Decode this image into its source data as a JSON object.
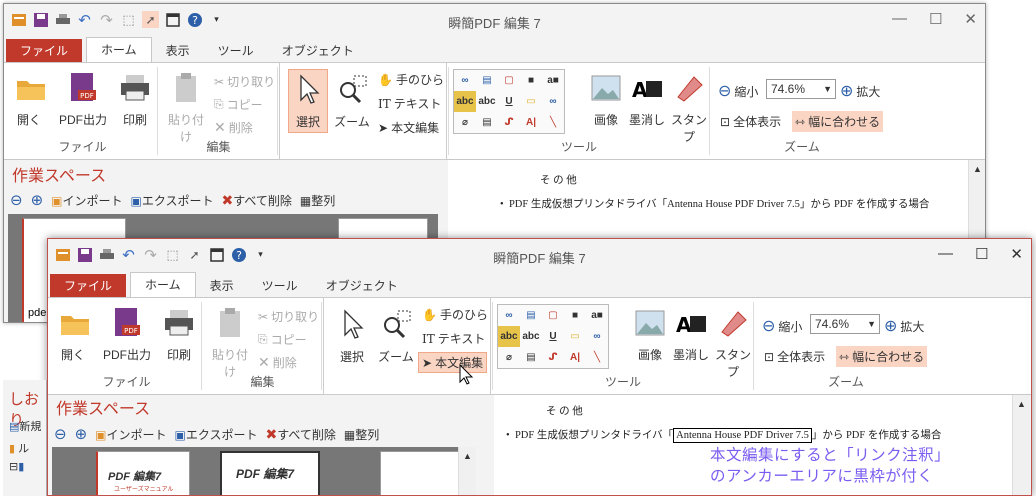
{
  "app_title": "瞬簡PDF 編集 7",
  "tabs": [
    "ファイル",
    "ホーム",
    "表示",
    "ツール",
    "オブジェクト"
  ],
  "groups": {
    "file": {
      "label": "ファイル",
      "open": "開く",
      "pdf_output": "PDF出力",
      "print": "印刷"
    },
    "edit": {
      "label": "編集",
      "paste": "貼り付け",
      "cut": "切り取り",
      "copy": "コピー",
      "delete": "削除"
    },
    "select": {
      "select": "選択",
      "zoom": "ズーム",
      "hand": "手のひら",
      "text": "テキスト",
      "body_edit": "本文編集"
    },
    "tools": {
      "label": "ツール",
      "image": "画像",
      "redact": "墨消し",
      "stamp": "スタンプ"
    },
    "zoom": {
      "label": "ズーム",
      "zoom_out": "縮小",
      "zoom_value": "74.6%",
      "zoom_in": "拡大",
      "fit_page": "全体表示",
      "fit_width": "幅に合わせる"
    }
  },
  "workspace": {
    "title": "作業スペース",
    "import": "インポート",
    "export": "エクスポート",
    "delete_all": "すべて削除",
    "arrange": "整列"
  },
  "side": {
    "bookmarks": "しおり",
    "new": "新規",
    "root": "ル",
    "pde": "pde"
  },
  "thumbs": {
    "t1": "PDF 編集7",
    "t1sub": "ユーザーズマニュアル",
    "t2": "PDF 編集7"
  },
  "document": {
    "heading": "そ の 他",
    "line_prefix": "PDF 生成仮想プリンタドライバ「",
    "anchor": "Antenna House PDF Driver 7.5",
    "line_suffix": "」から PDF を作成する場合"
  },
  "annotation": {
    "line1": "本文編集にすると「リンク注釈」",
    "line2": "のアンカーエリアに黒枠が付く"
  },
  "colors": {
    "accent": "#c0392b",
    "highlight": "#fbd5c4",
    "note": "#7b5cf0"
  }
}
